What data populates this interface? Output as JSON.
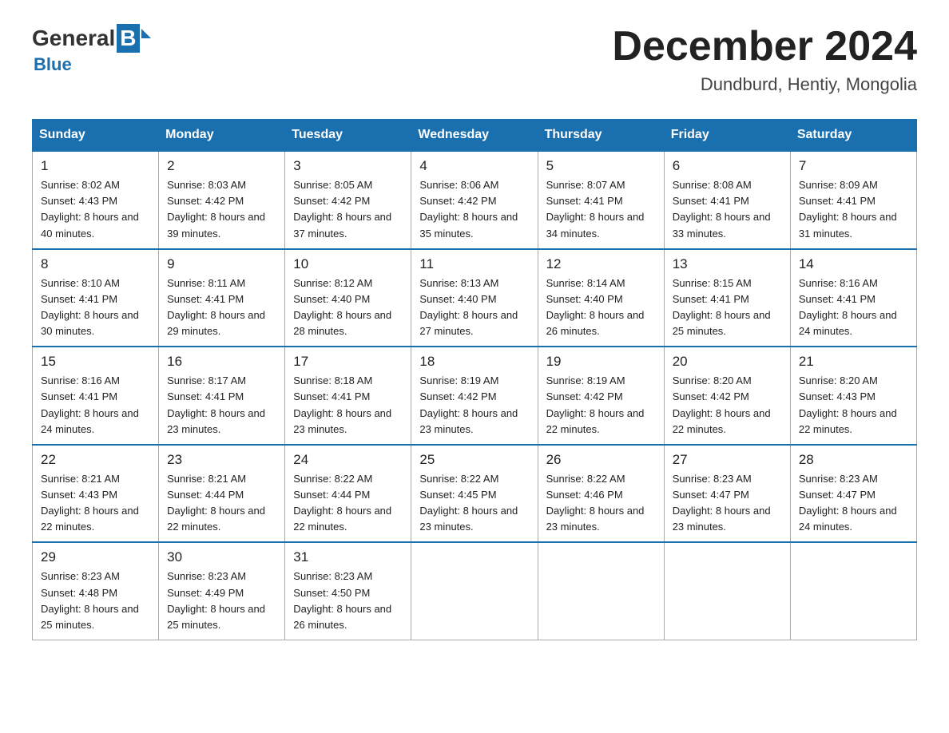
{
  "logo": {
    "general": "General",
    "blue": "Blue",
    "subtitle": "Blue"
  },
  "header": {
    "title": "December 2024",
    "location": "Dundburd, Hentiy, Mongolia"
  },
  "days_of_week": [
    "Sunday",
    "Monday",
    "Tuesday",
    "Wednesday",
    "Thursday",
    "Friday",
    "Saturday"
  ],
  "weeks": [
    [
      {
        "day": "1",
        "sunrise": "8:02 AM",
        "sunset": "4:43 PM",
        "daylight": "8 hours and 40 minutes."
      },
      {
        "day": "2",
        "sunrise": "8:03 AM",
        "sunset": "4:42 PM",
        "daylight": "8 hours and 39 minutes."
      },
      {
        "day": "3",
        "sunrise": "8:05 AM",
        "sunset": "4:42 PM",
        "daylight": "8 hours and 37 minutes."
      },
      {
        "day": "4",
        "sunrise": "8:06 AM",
        "sunset": "4:42 PM",
        "daylight": "8 hours and 35 minutes."
      },
      {
        "day": "5",
        "sunrise": "8:07 AM",
        "sunset": "4:41 PM",
        "daylight": "8 hours and 34 minutes."
      },
      {
        "day": "6",
        "sunrise": "8:08 AM",
        "sunset": "4:41 PM",
        "daylight": "8 hours and 33 minutes."
      },
      {
        "day": "7",
        "sunrise": "8:09 AM",
        "sunset": "4:41 PM",
        "daylight": "8 hours and 31 minutes."
      }
    ],
    [
      {
        "day": "8",
        "sunrise": "8:10 AM",
        "sunset": "4:41 PM",
        "daylight": "8 hours and 30 minutes."
      },
      {
        "day": "9",
        "sunrise": "8:11 AM",
        "sunset": "4:41 PM",
        "daylight": "8 hours and 29 minutes."
      },
      {
        "day": "10",
        "sunrise": "8:12 AM",
        "sunset": "4:40 PM",
        "daylight": "8 hours and 28 minutes."
      },
      {
        "day": "11",
        "sunrise": "8:13 AM",
        "sunset": "4:40 PM",
        "daylight": "8 hours and 27 minutes."
      },
      {
        "day": "12",
        "sunrise": "8:14 AM",
        "sunset": "4:40 PM",
        "daylight": "8 hours and 26 minutes."
      },
      {
        "day": "13",
        "sunrise": "8:15 AM",
        "sunset": "4:41 PM",
        "daylight": "8 hours and 25 minutes."
      },
      {
        "day": "14",
        "sunrise": "8:16 AM",
        "sunset": "4:41 PM",
        "daylight": "8 hours and 24 minutes."
      }
    ],
    [
      {
        "day": "15",
        "sunrise": "8:16 AM",
        "sunset": "4:41 PM",
        "daylight": "8 hours and 24 minutes."
      },
      {
        "day": "16",
        "sunrise": "8:17 AM",
        "sunset": "4:41 PM",
        "daylight": "8 hours and 23 minutes."
      },
      {
        "day": "17",
        "sunrise": "8:18 AM",
        "sunset": "4:41 PM",
        "daylight": "8 hours and 23 minutes."
      },
      {
        "day": "18",
        "sunrise": "8:19 AM",
        "sunset": "4:42 PM",
        "daylight": "8 hours and 23 minutes."
      },
      {
        "day": "19",
        "sunrise": "8:19 AM",
        "sunset": "4:42 PM",
        "daylight": "8 hours and 22 minutes."
      },
      {
        "day": "20",
        "sunrise": "8:20 AM",
        "sunset": "4:42 PM",
        "daylight": "8 hours and 22 minutes."
      },
      {
        "day": "21",
        "sunrise": "8:20 AM",
        "sunset": "4:43 PM",
        "daylight": "8 hours and 22 minutes."
      }
    ],
    [
      {
        "day": "22",
        "sunrise": "8:21 AM",
        "sunset": "4:43 PM",
        "daylight": "8 hours and 22 minutes."
      },
      {
        "day": "23",
        "sunrise": "8:21 AM",
        "sunset": "4:44 PM",
        "daylight": "8 hours and 22 minutes."
      },
      {
        "day": "24",
        "sunrise": "8:22 AM",
        "sunset": "4:44 PM",
        "daylight": "8 hours and 22 minutes."
      },
      {
        "day": "25",
        "sunrise": "8:22 AM",
        "sunset": "4:45 PM",
        "daylight": "8 hours and 23 minutes."
      },
      {
        "day": "26",
        "sunrise": "8:22 AM",
        "sunset": "4:46 PM",
        "daylight": "8 hours and 23 minutes."
      },
      {
        "day": "27",
        "sunrise": "8:23 AM",
        "sunset": "4:47 PM",
        "daylight": "8 hours and 23 minutes."
      },
      {
        "day": "28",
        "sunrise": "8:23 AM",
        "sunset": "4:47 PM",
        "daylight": "8 hours and 24 minutes."
      }
    ],
    [
      {
        "day": "29",
        "sunrise": "8:23 AM",
        "sunset": "4:48 PM",
        "daylight": "8 hours and 25 minutes."
      },
      {
        "day": "30",
        "sunrise": "8:23 AM",
        "sunset": "4:49 PM",
        "daylight": "8 hours and 25 minutes."
      },
      {
        "day": "31",
        "sunrise": "8:23 AM",
        "sunset": "4:50 PM",
        "daylight": "8 hours and 26 minutes."
      },
      null,
      null,
      null,
      null
    ]
  ],
  "labels": {
    "sunrise": "Sunrise:",
    "sunset": "Sunset:",
    "daylight": "Daylight:"
  },
  "accent_color": "#1a6faf"
}
